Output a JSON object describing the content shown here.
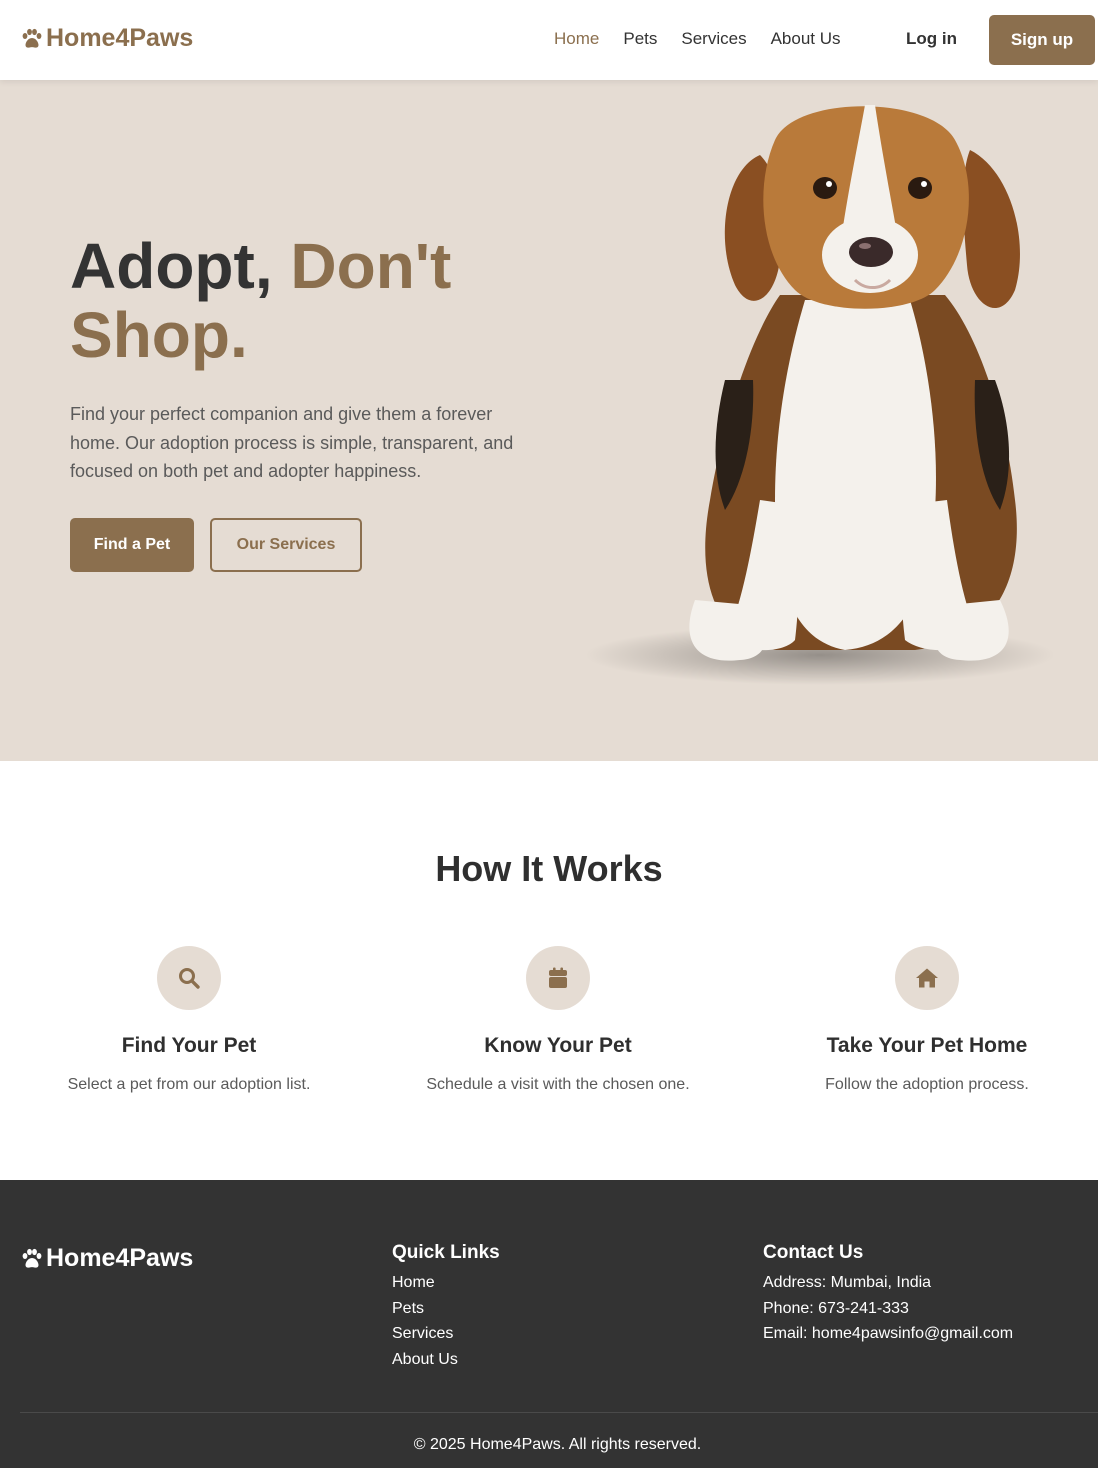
{
  "brand": {
    "name": "Home4Paws",
    "icon": "paw-icon",
    "color": "#8b6f4e"
  },
  "header": {
    "nav": [
      {
        "label": "Home",
        "active": true
      },
      {
        "label": "Pets",
        "active": false
      },
      {
        "label": "Services",
        "active": false
      },
      {
        "label": "About Us",
        "active": false
      }
    ],
    "login_label": "Log in",
    "signup_label": "Sign up"
  },
  "hero": {
    "title_dark": "Adopt,",
    "title_accent": "Don't Shop.",
    "description": "Find your perfect companion and give them a forever home. Our adoption process is simple, transparent, and focused on both pet and adopter happiness.",
    "primary_button": "Find a Pet",
    "secondary_button": "Our Services",
    "background": "#e5dcd3"
  },
  "how_it_works": {
    "title": "How It Works",
    "steps": [
      {
        "icon": "search-icon",
        "title": "Find Your Pet",
        "text": "Select a pet from our adoption list."
      },
      {
        "icon": "calendar-icon",
        "title": "Know Your Pet",
        "text": "Schedule a visit with the chosen one."
      },
      {
        "icon": "home-icon",
        "title": "Take Your Pet Home",
        "text": "Follow the adoption process."
      }
    ]
  },
  "footer": {
    "quick_links_title": "Quick Links",
    "quick_links": [
      "Home",
      "Pets",
      "Services",
      "About Us"
    ],
    "contact_title": "Contact Us",
    "contact": [
      "Address: Mumbai, India",
      "Phone: 673-241-333",
      "Email: home4pawsinfo@gmail.com"
    ],
    "copyright": "© 2025 Home4Paws. All rights reserved.",
    "background": "#333333"
  }
}
